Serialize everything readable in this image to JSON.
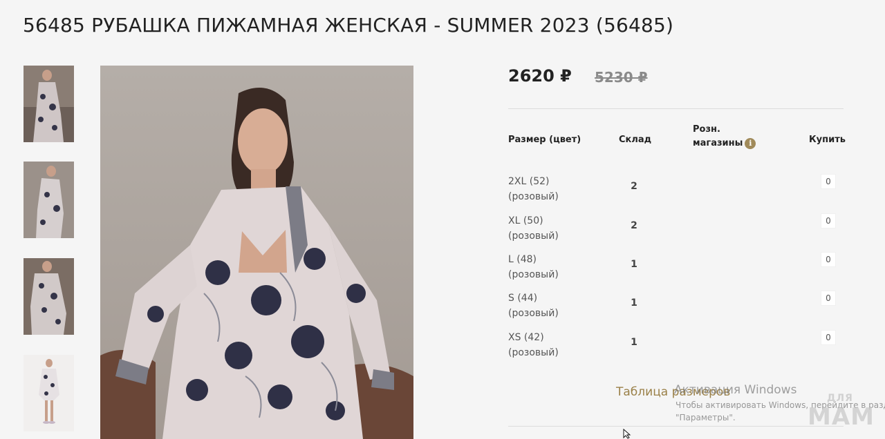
{
  "product": {
    "title": "56485 РУБАШКА ПИЖАМНАЯ ЖЕНСКАЯ - SUMMER 2023 (56485)",
    "price": "2620 ₽",
    "old_price": "5230 ₽"
  },
  "table": {
    "headers": {
      "size": "Размер (цвет)",
      "stock": "Склад",
      "retail_line1": "Розн.",
      "retail_line2": "магазины",
      "buy": "Купить"
    },
    "info_icon_glyph": "i",
    "rows": [
      {
        "size": "2XL (52)",
        "color": "(розовый)",
        "stock": "2",
        "qty": "0"
      },
      {
        "size": "XL (50)",
        "color": "(розовый)",
        "stock": "2",
        "qty": "0"
      },
      {
        "size": "L (48)",
        "color": "(розовый)",
        "stock": "1",
        "qty": "0"
      },
      {
        "size": "S (44)",
        "color": "(розовый)",
        "stock": "1",
        "qty": "0"
      },
      {
        "size": "XS (42)",
        "color": "(розовый)",
        "stock": "1",
        "qty": "0"
      }
    ]
  },
  "size_table_link": "Таблица размеров",
  "windows_activation": {
    "title": "Активация Windows",
    "line1": "Чтобы активировать Windows, перейдите в разде",
    "line2": "\"Параметры\"."
  },
  "watermark": {
    "small": "ДЛЯ",
    "big": "МАМ"
  },
  "colors": {
    "accent_gold": "#9a8048",
    "info_icon": "#a08a5a",
    "old_price": "#8a8a8a",
    "background": "#f5f5f5"
  },
  "icons": [
    "info-icon",
    "mouse-cursor-icon"
  ]
}
